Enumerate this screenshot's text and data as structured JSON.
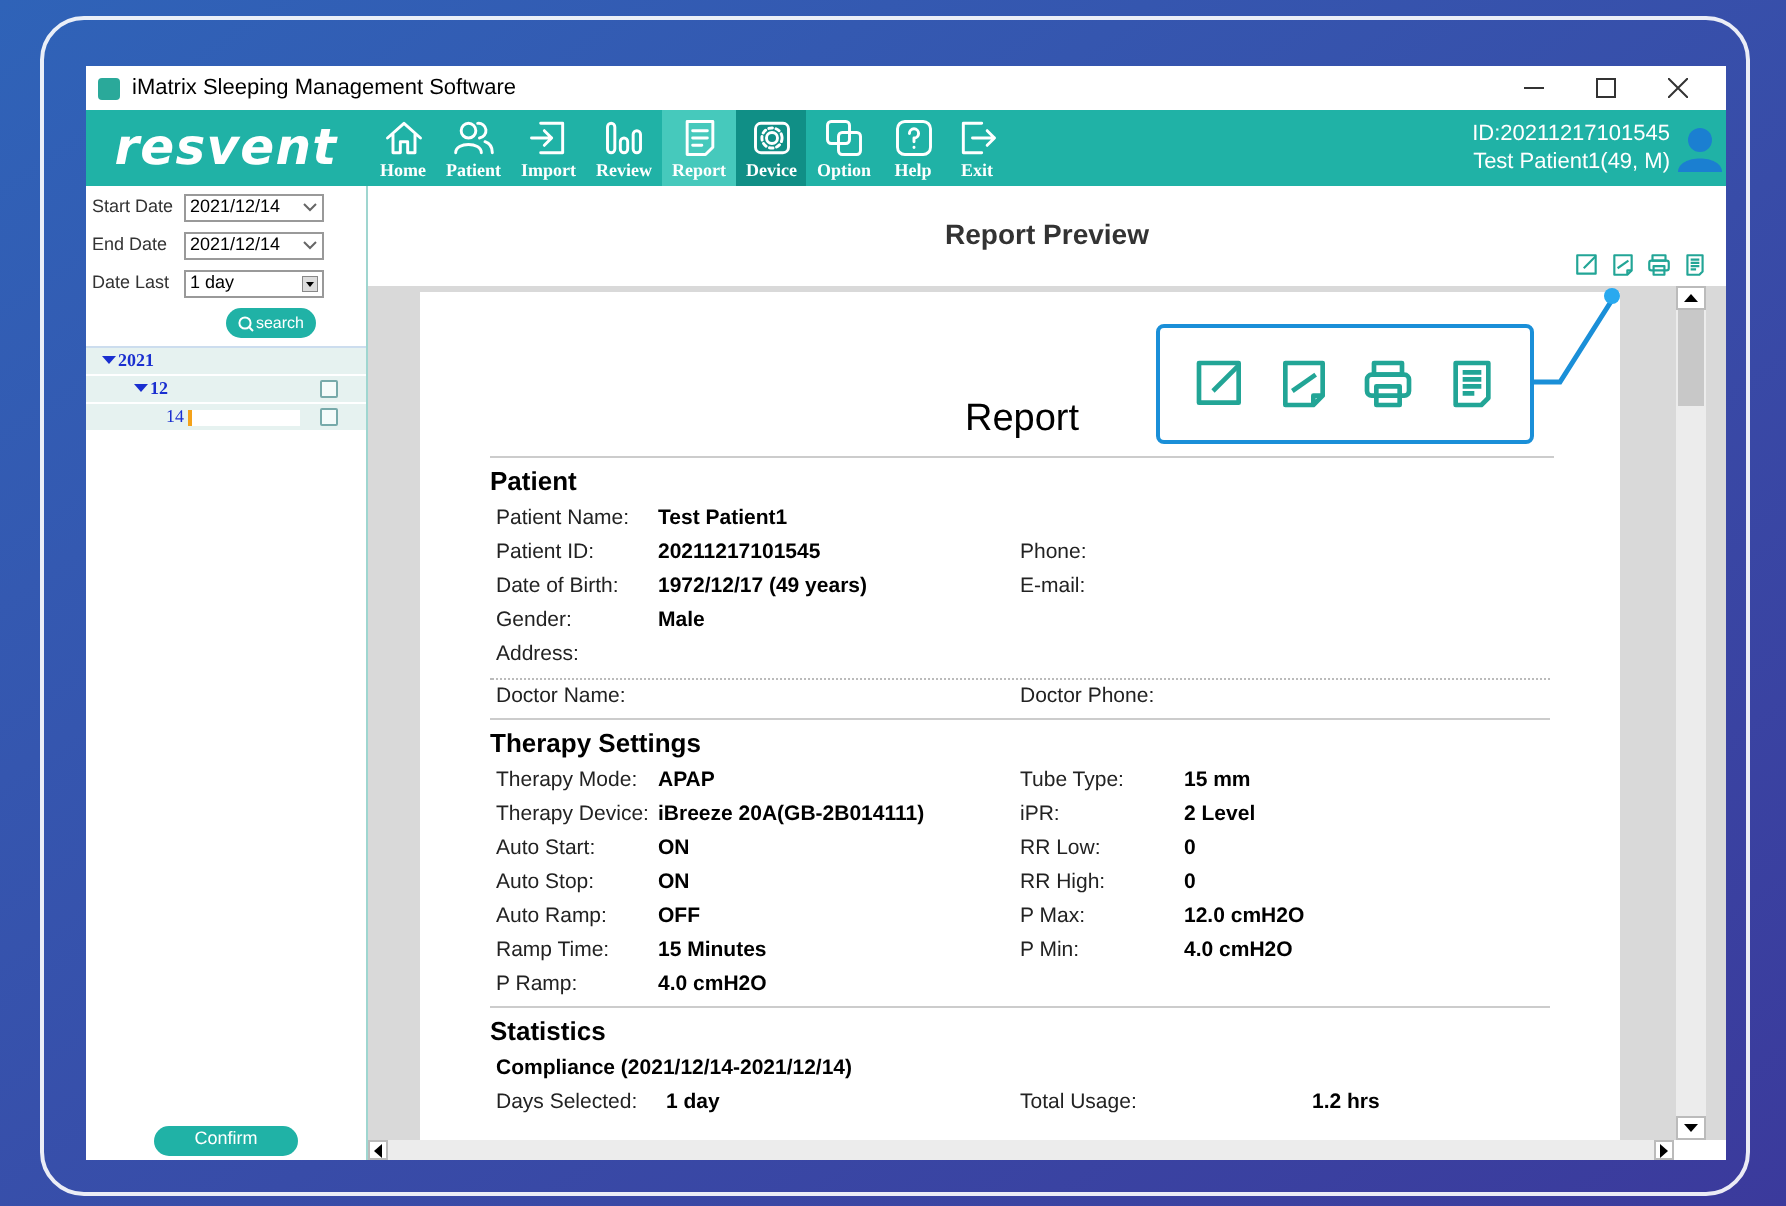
{
  "window": {
    "title": "iMatrix Sleeping Management Software"
  },
  "toolbar": {
    "logo": "resvent",
    "nav": [
      {
        "label": "Home",
        "selected": false,
        "highlighted": false
      },
      {
        "label": "Patient",
        "selected": false,
        "highlighted": false
      },
      {
        "label": "Import",
        "selected": false,
        "highlighted": false
      },
      {
        "label": "Review",
        "selected": false,
        "highlighted": false
      },
      {
        "label": "Report",
        "selected": true,
        "highlighted": false
      },
      {
        "label": "Device",
        "selected": false,
        "highlighted": true
      },
      {
        "label": "Option",
        "selected": false,
        "highlighted": false
      },
      {
        "label": "Help",
        "selected": false,
        "highlighted": false
      },
      {
        "label": "Exit",
        "selected": false,
        "highlighted": false
      }
    ],
    "patient_id": "ID:20211217101545",
    "patient_name": "Test Patient1(49, M)"
  },
  "sidebar": {
    "filters": [
      {
        "label": "Start Date",
        "value": "2021/12/14",
        "kind": "date"
      },
      {
        "label": "End Date",
        "value": "2021/12/14",
        "kind": "date"
      },
      {
        "label": "Date Last",
        "value": "1 day",
        "kind": "combo"
      }
    ],
    "search_button": "search",
    "tree": [
      {
        "label": "2021",
        "expanded": true,
        "children": [
          {
            "label": "12",
            "expanded": true,
            "checked": false,
            "children": [
              {
                "label": "14",
                "checked": false,
                "level": 0.03
              }
            ]
          }
        ]
      }
    ],
    "confirm_button": "Confirm"
  },
  "report": {
    "title": "Report Preview",
    "page_title": "Report",
    "sections": [
      {
        "heading": "Patient",
        "rows": [
          {
            "label": "Patient Name:",
            "value": "Test Patient1"
          },
          {
            "label": "Patient ID:",
            "value": "20211217101545",
            "label2": "Phone:"
          },
          {
            "label": "Date of Birth:",
            "value": "1972/12/17 (49 years)",
            "label2": "E-mail:"
          },
          {
            "label": "Gender:",
            "value": "Male"
          },
          {
            "label": "Address:"
          },
          {
            "label": "Doctor Name:",
            "label2": "Doctor Phone:",
            "kind": "doctor"
          }
        ]
      },
      {
        "heading": "Therapy Settings",
        "rows": [
          {
            "label": "Therapy Mode:",
            "value": "APAP",
            "label2": "Tube Type:",
            "value2": "15 mm"
          },
          {
            "label": "Therapy Device:",
            "value": "iBreeze 20A(GB-2B014111)",
            "label2": "iPR:",
            "value2": "2 Level"
          },
          {
            "label": "Auto Start:",
            "value": "ON",
            "label2": "RR Low:",
            "value2": "0"
          },
          {
            "label": "Auto Stop:",
            "value": "ON",
            "label2": "RR High:",
            "value2": "0"
          },
          {
            "label": "Auto Ramp:",
            "value": "OFF",
            "label2": "P Max:",
            "value2": "12.0 cmH2O"
          },
          {
            "label": "Ramp Time:",
            "value": "15 Minutes",
            "label2": "P Min:",
            "value2": "4.0 cmH2O"
          },
          {
            "label": "P Ramp:",
            "value": "4.0 cmH2O"
          }
        ]
      },
      {
        "heading": "Statistics",
        "subheading": "Compliance (2021/12/14-2021/12/14)",
        "rows": [
          {
            "label": "Days Selected:",
            "value": "1 day",
            "label2": "Total Usage:",
            "value2": "1.2 hrs",
            "kind": "wide"
          }
        ]
      }
    ]
  }
}
